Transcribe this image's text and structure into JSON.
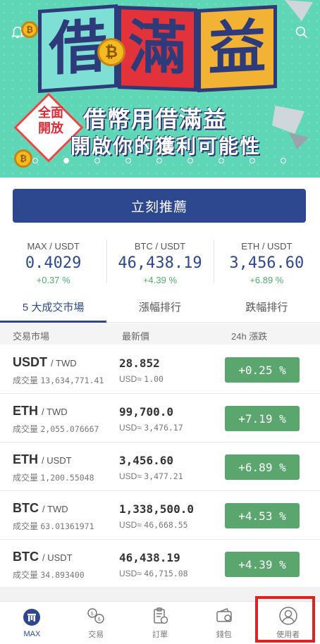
{
  "banner": {
    "title_chars": [
      "借",
      "滿",
      "益"
    ],
    "badge": [
      "全面",
      "開放"
    ],
    "subtitle1": "借幣用借滿益",
    "subtitle2": "開啟你的獲利可能性",
    "coin_icon": "bitcoin-coin-icon",
    "coin_icon2": "max-coin-icon",
    "page_count": 9,
    "active_page": 1
  },
  "recommend_button": "立刻推薦",
  "tickers": [
    {
      "pair": "MAX / USDT",
      "price": "0.4029",
      "change": "+0.37 %"
    },
    {
      "pair": "BTC / USDT",
      "price": "46,438.19",
      "change": "+4.39 %"
    },
    {
      "pair": "ETH / USDT",
      "price": "3,456.60",
      "change": "+6.89 %"
    }
  ],
  "tabs": [
    "5 大成交市場",
    "漲幅排行",
    "跌幅排行"
  ],
  "columns": {
    "market": "交易市場",
    "price": "最新價",
    "change": "24h 漲跌"
  },
  "labels": {
    "volume": "成交量",
    "usd": "USD≈"
  },
  "rows": [
    {
      "base": "USDT",
      "quote": "/ TWD",
      "volume": "13,634,771.41",
      "price": "28.852",
      "usd": "1.00",
      "change": "+0.25 %"
    },
    {
      "base": "ETH",
      "quote": "/ TWD",
      "volume": "2,055.076667",
      "price": "99,700.0",
      "usd": "3,476.17",
      "change": "+7.19 %"
    },
    {
      "base": "ETH",
      "quote": "/ USDT",
      "volume": "1,200.55048",
      "price": "3,456.60",
      "usd": "3,477.21",
      "change": "+6.89 %"
    },
    {
      "base": "BTC",
      "quote": "/ TWD",
      "volume": "63.01361971",
      "price": "1,338,500.0",
      "usd": "46,668.55",
      "change": "+4.53 %"
    },
    {
      "base": "BTC",
      "quote": "/ USDT",
      "volume": "34.893400",
      "price": "46,438.19",
      "usd": "46,715.08",
      "change": "+4.39 %"
    }
  ],
  "nav": [
    {
      "label": "MAX",
      "icon": "max-home-icon"
    },
    {
      "label": "交易",
      "icon": "exchange-icon"
    },
    {
      "label": "訂單",
      "icon": "order-clipboard-icon"
    },
    {
      "label": "錢包",
      "icon": "wallet-icon"
    },
    {
      "label": "使用者",
      "icon": "user-icon"
    }
  ],
  "colors": {
    "primary": "#2e4890",
    "positive": "#5ba56e",
    "banner": "#5fd6b6",
    "highlight": "#e0231f"
  }
}
